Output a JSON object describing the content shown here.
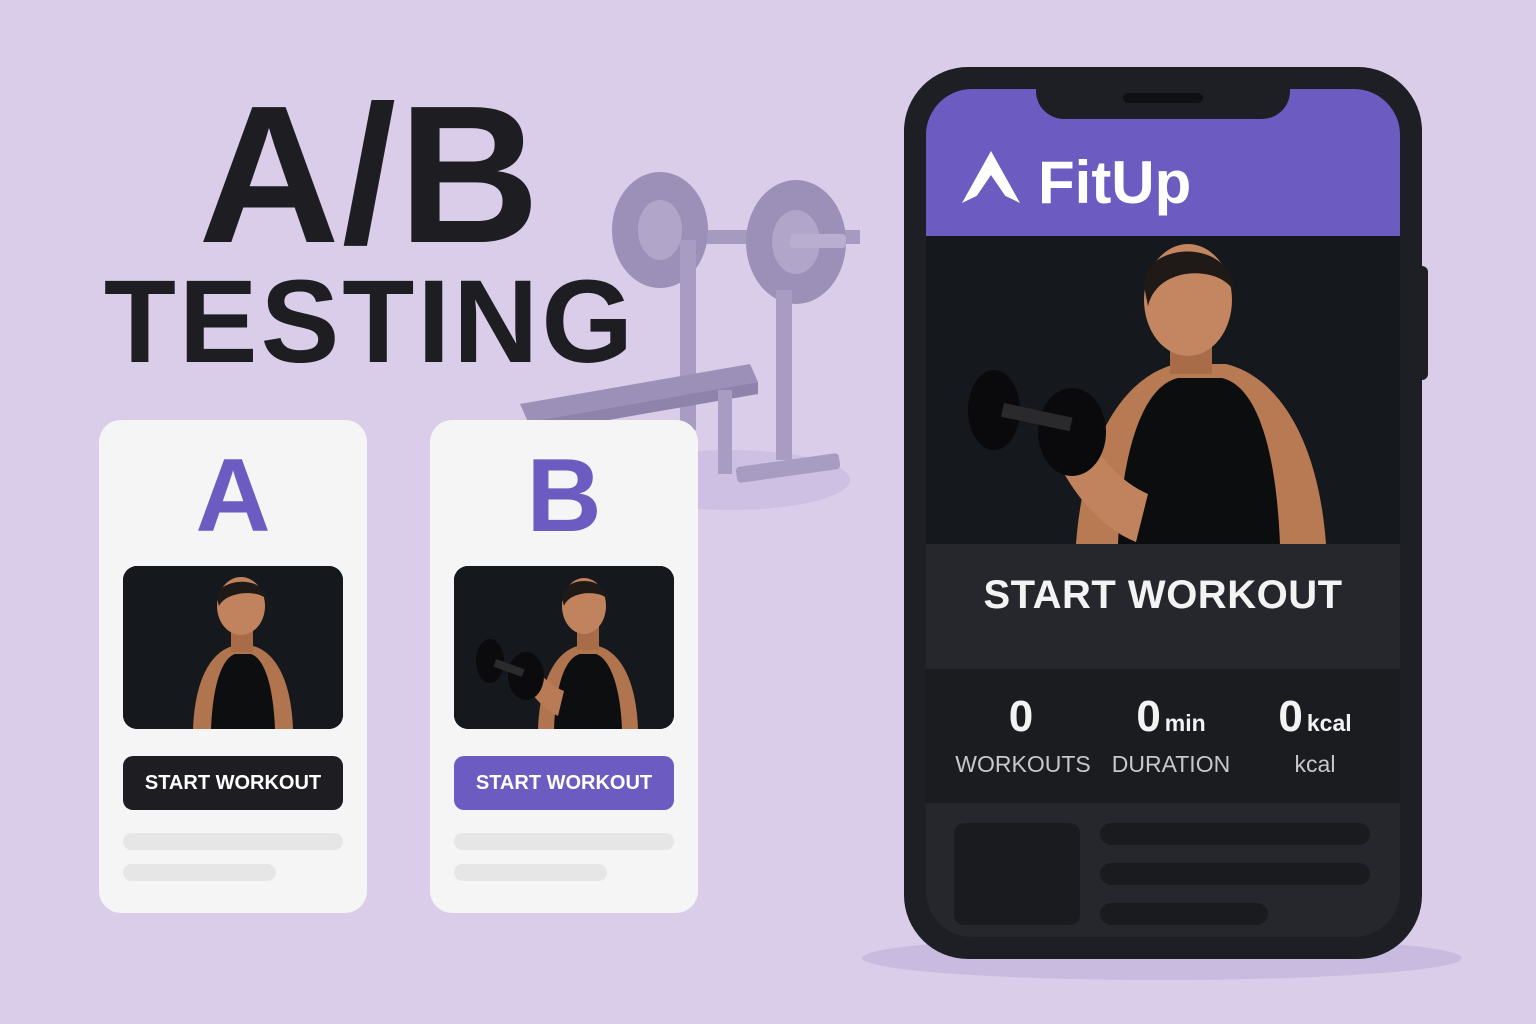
{
  "headline": {
    "line1": "A/B",
    "line2": "TESTING"
  },
  "variants": [
    {
      "letter": "A",
      "button_label": "START WORKOUT",
      "button_color": "#1d1d22",
      "image": "man-looking-down"
    },
    {
      "letter": "B",
      "button_label": "START WORKOUT",
      "button_color": "#6c5bc0",
      "image": "man-curling-dumbbell"
    }
  ],
  "decor": {
    "icon": "barbell-bench-icon"
  },
  "phone": {
    "brand": "FitUp",
    "logo_icon": "arrow-up-logo-icon",
    "hero_image": "man-curling-dumbbell",
    "cta_label": "START WORKOUT",
    "stats": [
      {
        "value": "0",
        "unit": "",
        "label": "WORKOUTS"
      },
      {
        "value": "0",
        "unit": "min",
        "label": "DURATION"
      },
      {
        "value": "0",
        "unit": "kcal",
        "label": "kcal"
      }
    ]
  },
  "colors": {
    "background": "#d9cde9",
    "accent": "#6c5bc0",
    "dark": "#1d1d22",
    "phone": "#1e1f24"
  }
}
